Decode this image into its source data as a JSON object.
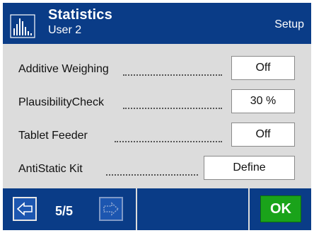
{
  "header": {
    "title": "Statistics",
    "subtitle": "User 2",
    "mode": "Setup",
    "icon": "statistics-histogram-icon"
  },
  "settings": [
    {
      "label": "Additive Weighing",
      "value": "Off"
    },
    {
      "label": "PlausibilityCheck",
      "value": "30 %"
    },
    {
      "label": "Tablet Feeder",
      "value": "Off"
    },
    {
      "label": "AntiStatic Kit",
      "value": "Define"
    }
  ],
  "footer": {
    "back_icon": "arrow-left-icon",
    "page_indicator": "5/5",
    "next_icon": "arrow-right-icon",
    "ok_label": "OK"
  },
  "colors": {
    "header_bg": "#0a3c87",
    "content_bg": "#dcdcdc",
    "ok_green": "#1aa31a"
  }
}
